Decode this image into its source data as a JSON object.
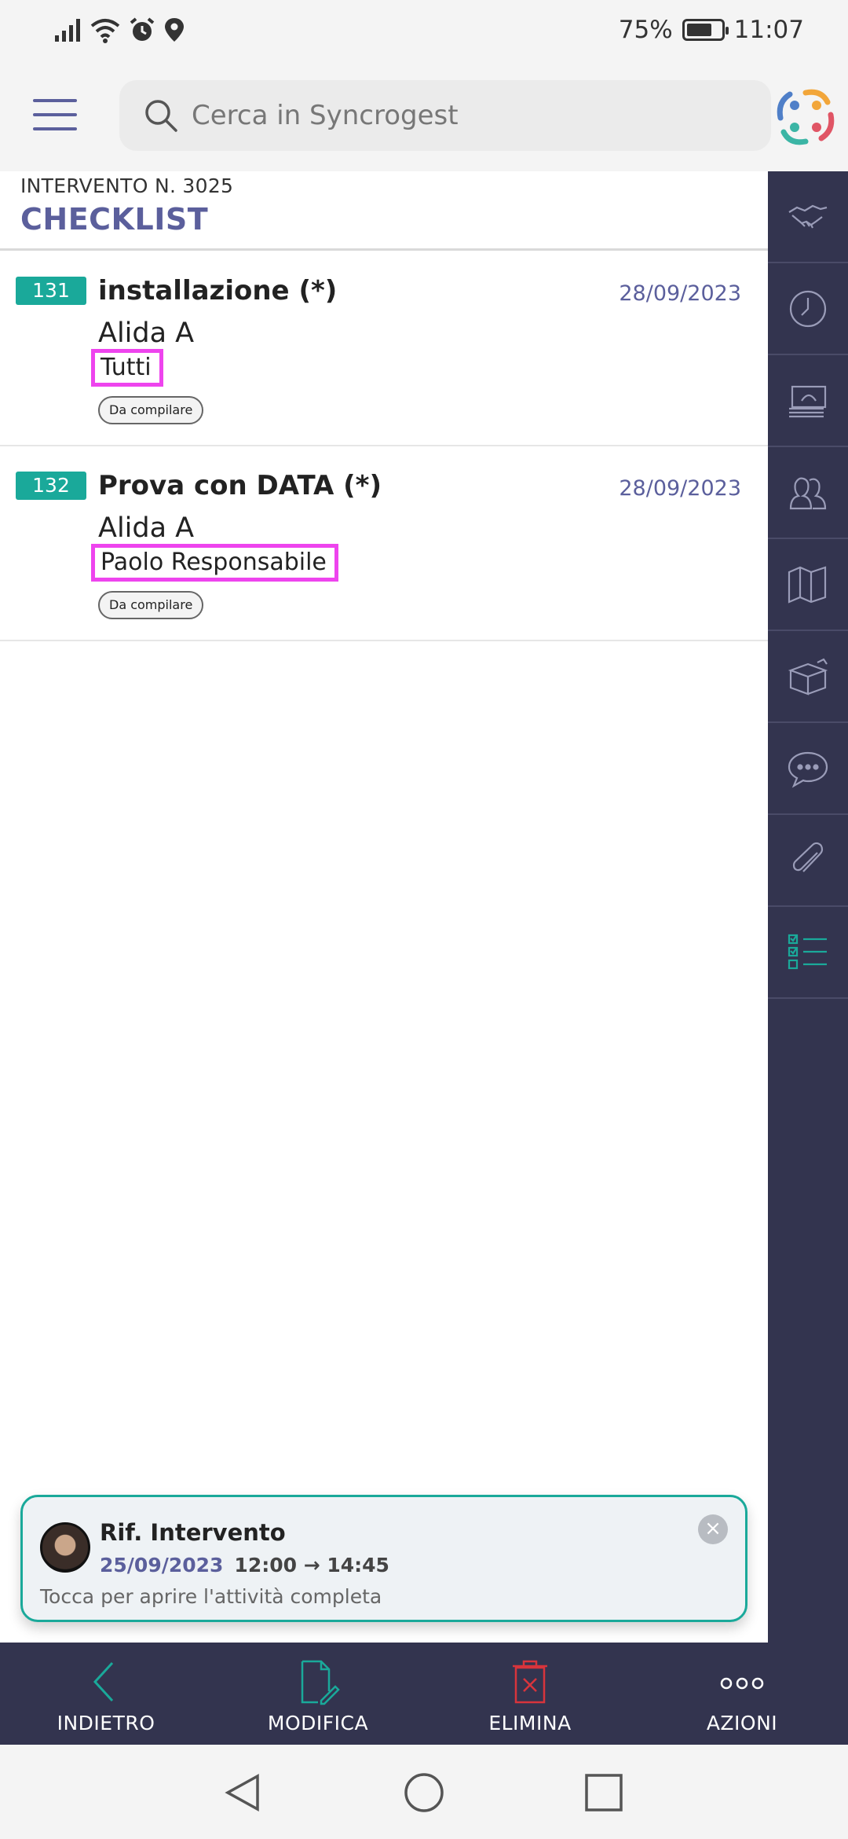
{
  "status_bar": {
    "battery": "75%",
    "battery_level": 0.75,
    "time": "11:07",
    "icons": [
      "signal-icon",
      "wifi-icon",
      "alarm-icon",
      "location-icon"
    ]
  },
  "header": {
    "search_placeholder": "Cerca in Syncrogest"
  },
  "page": {
    "subtitle": "INTERVENTO N. 3025",
    "title": "CHECKLIST"
  },
  "checklist": [
    {
      "number": "131",
      "title": "installazione (*)",
      "date": "28/09/2023",
      "owner": "Alida A",
      "assignee": "Tutti",
      "status": "Da compilare"
    },
    {
      "number": "132",
      "title": "Prova con DATA (*)",
      "date": "28/09/2023",
      "owner": "Alida A",
      "assignee": "Paolo Responsabile",
      "status": "Da compilare"
    }
  ],
  "rail": {
    "items": [
      "handshake-icon",
      "clock-icon",
      "money-icon",
      "people-icon",
      "map-icon",
      "box-icon",
      "chat-icon",
      "paperclip-icon",
      "checklist-icon"
    ],
    "active": "checklist-icon"
  },
  "notification": {
    "title": "Rif. Intervento",
    "date": "25/09/2023",
    "time_range": "12:00 → 14:45",
    "hint": "Tocca per aprire l'attività completa"
  },
  "actions": {
    "back": "INDIETRO",
    "edit": "MODIFICA",
    "delete": "ELIMINA",
    "more": "AZIONI"
  },
  "colors": {
    "accent_teal": "#1aa99a",
    "brand_purple": "#5b5f9c",
    "dark_bar": "#33344f",
    "highlight_magenta": "#ee44ee",
    "delete_red": "#d8343c"
  }
}
